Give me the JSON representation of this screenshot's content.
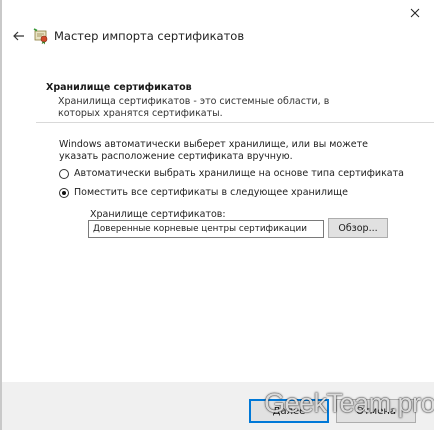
{
  "window": {
    "title": "Мастер импорта сертификатов",
    "back_icon": "arrow-left-icon",
    "wizard_icon": "certificate-icon",
    "close_icon": "close-icon"
  },
  "header": {
    "title": "Хранилище сертификатов",
    "description": "Хранилища сертификатов - это системные области, в которых хранятся сертификаты."
  },
  "content": {
    "intro": "Windows автоматически выберет хранилище, или вы можете указать расположение сертификата вручную.",
    "options": [
      {
        "label": "Автоматически выбрать хранилище на основе типа сертификата",
        "selected": false
      },
      {
        "label": "Поместить все сертификаты в следующее хранилище",
        "selected": true
      }
    ],
    "store_label": "Хранилище сертификатов:",
    "store_value": "Доверенные корневые центры сертификации",
    "browse_label": "Обзор..."
  },
  "footer": {
    "next_label": "Далее",
    "cancel_label": "Отмена"
  },
  "watermark": "GeekTeam.pro",
  "colors": {
    "accent": "#0078d7",
    "background": "#ffffff",
    "footer": "#f0f0f0"
  }
}
